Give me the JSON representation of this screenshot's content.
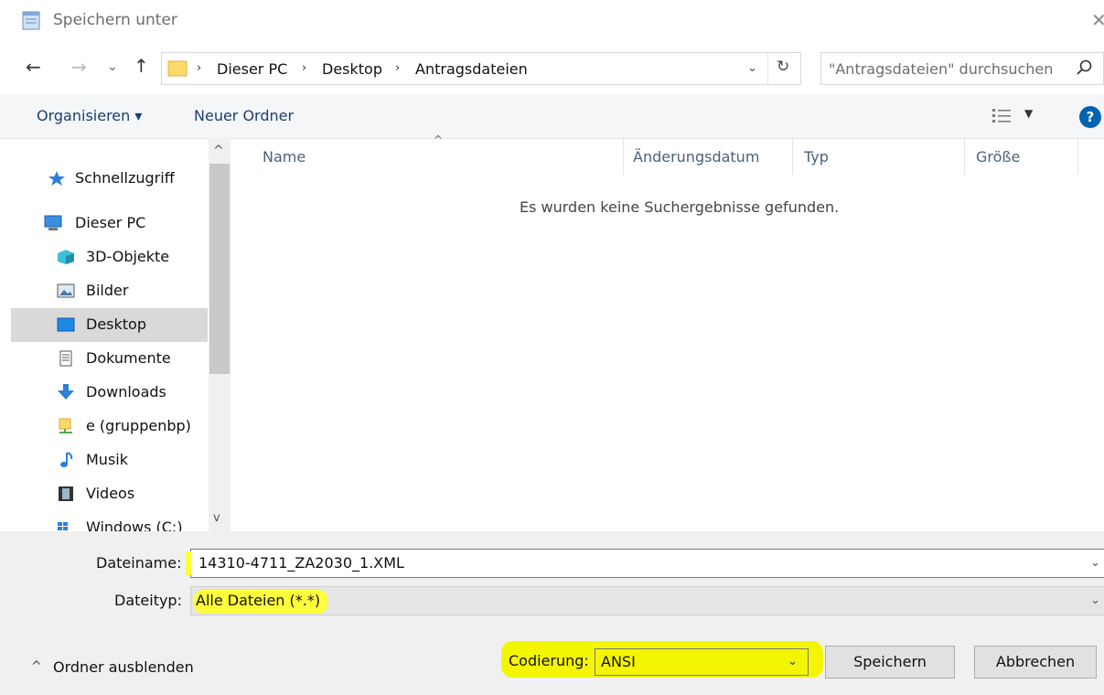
{
  "window": {
    "title": "Speichern unter",
    "close_glyph": "✕"
  },
  "nav": {
    "back_glyph": "←",
    "forward_glyph": "→",
    "recent_glyph": "⌄",
    "up_glyph": "↑",
    "breadcrumb": [
      "Dieser PC",
      "Desktop",
      "Antragsdateien"
    ],
    "separator_glyph": "›",
    "dropdown_glyph": "⌄",
    "refresh_glyph": "↻",
    "search_placeholder": "\"Antragsdateien\" durchsuchen"
  },
  "toolbar": {
    "organize_label": "Organisieren ▾",
    "new_folder_label": "Neuer Ordner",
    "view_drop_glyph": "▼",
    "help_glyph": "?"
  },
  "sidebar": {
    "scroll_up_glyph": "^",
    "scroll_down_glyph": "v",
    "items": [
      {
        "label": "Schnellzugriff",
        "icon": "star-icon"
      },
      {
        "label": "Dieser PC",
        "icon": "computer-icon"
      },
      {
        "label": "3D-Objekte",
        "icon": "cube-icon"
      },
      {
        "label": "Bilder",
        "icon": "pictures-icon"
      },
      {
        "label": "Desktop",
        "icon": "desktop-icon",
        "selected": true
      },
      {
        "label": "Dokumente",
        "icon": "document-icon"
      },
      {
        "label": "Downloads",
        "icon": "download-icon"
      },
      {
        "label": "e (gruppenbp)",
        "icon": "network-drive-icon"
      },
      {
        "label": "Musik",
        "icon": "music-icon"
      },
      {
        "label": "Videos",
        "icon": "video-icon"
      },
      {
        "label": "Windows (C:)",
        "icon": "windows-drive-icon"
      }
    ]
  },
  "list": {
    "sort_glyph": "^",
    "columns": [
      "Name",
      "Änderungsdatum",
      "Typ",
      "Größe"
    ],
    "empty_message": "Es wurden keine Suchergebnisse gefunden."
  },
  "form": {
    "filename_label": "Dateiname:",
    "filename_value": "14310-4711_ZA2030_1.XML",
    "filetype_label": "Dateityp:",
    "filetype_value": "Alle Dateien  (*.*)",
    "field_drop_glyph": "⌄",
    "hide_folders_glyph": "^",
    "hide_folders_label": "Ordner ausblenden",
    "encoding_label": "Codierung:",
    "encoding_value": "ANSI",
    "encoding_drop_glyph": "⌄",
    "save_label": "Speichern",
    "cancel_label": "Abbrechen"
  },
  "colors": {
    "highlight": "#f4f500",
    "accent": "#0063b1",
    "selection": "#d9d9d9"
  }
}
